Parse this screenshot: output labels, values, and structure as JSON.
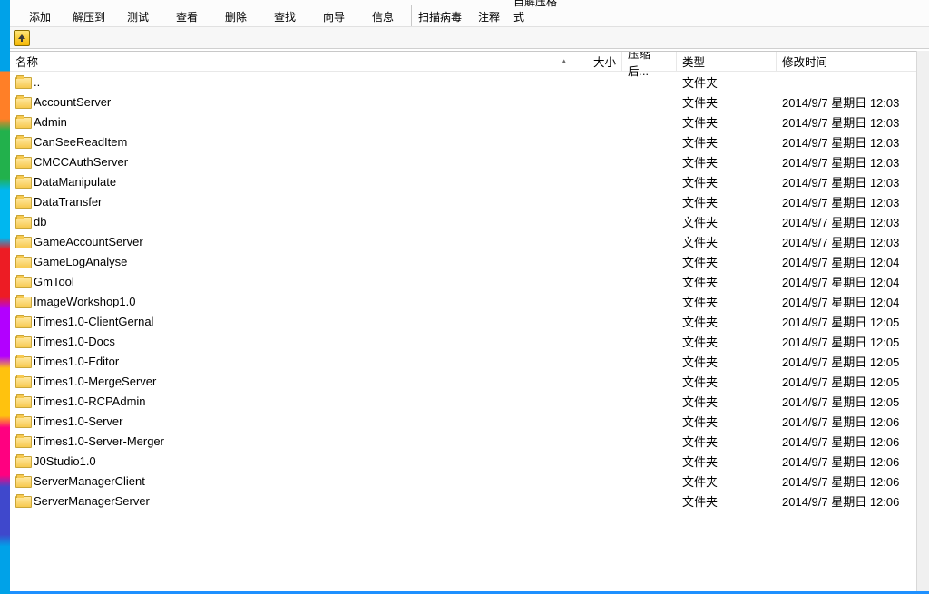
{
  "toolbar": {
    "items": [
      {
        "label": "添加",
        "color": "#8b5a2b"
      },
      {
        "label": "解压到",
        "color": "#8b5a2b"
      },
      {
        "label": "测试",
        "color": "#1f7a1f"
      },
      {
        "label": "查看",
        "color": "#0f4aa8"
      },
      {
        "label": "删除",
        "color": "#b00020"
      },
      {
        "label": "查找",
        "color": "#0f4aa8"
      },
      {
        "label": "向导",
        "color": "#6a0dad"
      },
      {
        "label": "信息",
        "color": "#0f4aa8"
      }
    ],
    "items2": [
      {
        "label": "扫描病毒",
        "color": "#1f7a1f"
      },
      {
        "label": "注释",
        "color": "#d49a00"
      },
      {
        "label": "自解压格式",
        "color": "#b00020"
      }
    ]
  },
  "columns": {
    "name": "名称",
    "size": "大小",
    "packed": "压缩后...",
    "type": "类型",
    "modified": "修改时间"
  },
  "rows": [
    {
      "name": "..",
      "type": "文件夹",
      "date": "",
      "up": true
    },
    {
      "name": "AccountServer",
      "type": "文件夹",
      "date": "2014/9/7 星期日 12:03"
    },
    {
      "name": "Admin",
      "type": "文件夹",
      "date": "2014/9/7 星期日 12:03"
    },
    {
      "name": "CanSeeReadItem",
      "type": "文件夹",
      "date": "2014/9/7 星期日 12:03"
    },
    {
      "name": "CMCCAuthServer",
      "type": "文件夹",
      "date": "2014/9/7 星期日 12:03"
    },
    {
      "name": "DataManipulate",
      "type": "文件夹",
      "date": "2014/9/7 星期日 12:03"
    },
    {
      "name": "DataTransfer",
      "type": "文件夹",
      "date": "2014/9/7 星期日 12:03"
    },
    {
      "name": "db",
      "type": "文件夹",
      "date": "2014/9/7 星期日 12:03"
    },
    {
      "name": "GameAccountServer",
      "type": "文件夹",
      "date": "2014/9/7 星期日 12:03"
    },
    {
      "name": "GameLogAnalyse",
      "type": "文件夹",
      "date": "2014/9/7 星期日 12:04"
    },
    {
      "name": "GmTool",
      "type": "文件夹",
      "date": "2014/9/7 星期日 12:04"
    },
    {
      "name": "ImageWorkshop1.0",
      "type": "文件夹",
      "date": "2014/9/7 星期日 12:04"
    },
    {
      "name": "iTimes1.0-ClientGernal",
      "type": "文件夹",
      "date": "2014/9/7 星期日 12:05"
    },
    {
      "name": "iTimes1.0-Docs",
      "type": "文件夹",
      "date": "2014/9/7 星期日 12:05"
    },
    {
      "name": "iTimes1.0-Editor",
      "type": "文件夹",
      "date": "2014/9/7 星期日 12:05"
    },
    {
      "name": "iTimes1.0-MergeServer",
      "type": "文件夹",
      "date": "2014/9/7 星期日 12:05"
    },
    {
      "name": "iTimes1.0-RCPAdmin",
      "type": "文件夹",
      "date": "2014/9/7 星期日 12:05"
    },
    {
      "name": "iTimes1.0-Server",
      "type": "文件夹",
      "date": "2014/9/7 星期日 12:06"
    },
    {
      "name": "iTimes1.0-Server-Merger",
      "type": "文件夹",
      "date": "2014/9/7 星期日 12:06"
    },
    {
      "name": "J0Studio1.0",
      "type": "文件夹",
      "date": "2014/9/7 星期日 12:06"
    },
    {
      "name": "ServerManagerClient",
      "type": "文件夹",
      "date": "2014/9/7 星期日 12:06"
    },
    {
      "name": "ServerManagerServer",
      "type": "文件夹",
      "date": "2014/9/7 星期日 12:06"
    }
  ]
}
